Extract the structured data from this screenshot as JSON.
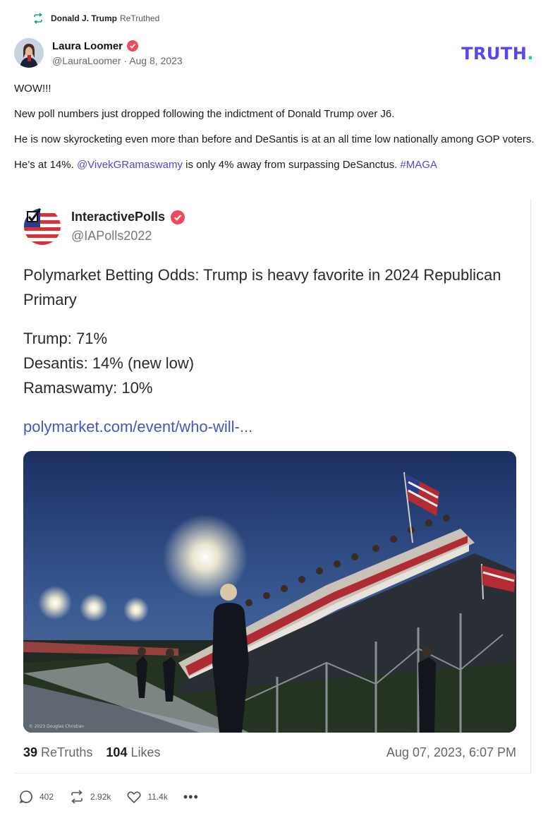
{
  "retruth": {
    "name": "Donald J. Trump",
    "label": "ReTruthed",
    "icon": "retruth-icon"
  },
  "author": {
    "name": "Laura Loomer",
    "handle": "@LauraLoomer",
    "separator": "·",
    "date": "Aug 8, 2023",
    "verified_icon": "verified-badge-icon"
  },
  "brand": {
    "logo_text": "TRUTH",
    "logo_dot": ".",
    "color": "#5448ee",
    "dot_color": "#17d1bb"
  },
  "post": {
    "line1": "WOW!!!",
    "line2": "New poll numbers just dropped following the indictment of Donald Trump over J6.",
    "line3": "He is now skyrocketing even more than before and DeSantis is at an all time low nationally among GOP voters.",
    "line4_pre": "He’s at 14%. ",
    "line4_mention": "@VivekGRamaswamy",
    "line4_mid": " is only 4% away from surpassing DeSanctus. ",
    "line4_hashtag": "#MAGA",
    "link_color": "#4e48d4"
  },
  "embed": {
    "name": "InteractivePolls",
    "handle": "@IAPolls2022",
    "headline": "Polymarket Betting Odds: Trump is heavy favorite in 2024 Republican Primary",
    "odds": [
      "Trump: 71%",
      "Desantis: 14% (new low)",
      "Ramaswamy: 10%"
    ],
    "link": "polymarket.com/event/who-will-...",
    "retruths_count": "39",
    "retruths_label": "ReTruths",
    "likes_count": "104",
    "likes_label": "Likes",
    "timestamp": "Aug 07, 2023, 6:07 PM",
    "photo_watermark": "© 2023 Douglas Christian"
  },
  "actions": {
    "replies": "402",
    "retruths": "2.92k",
    "likes": "11.4k",
    "more": "•••"
  }
}
